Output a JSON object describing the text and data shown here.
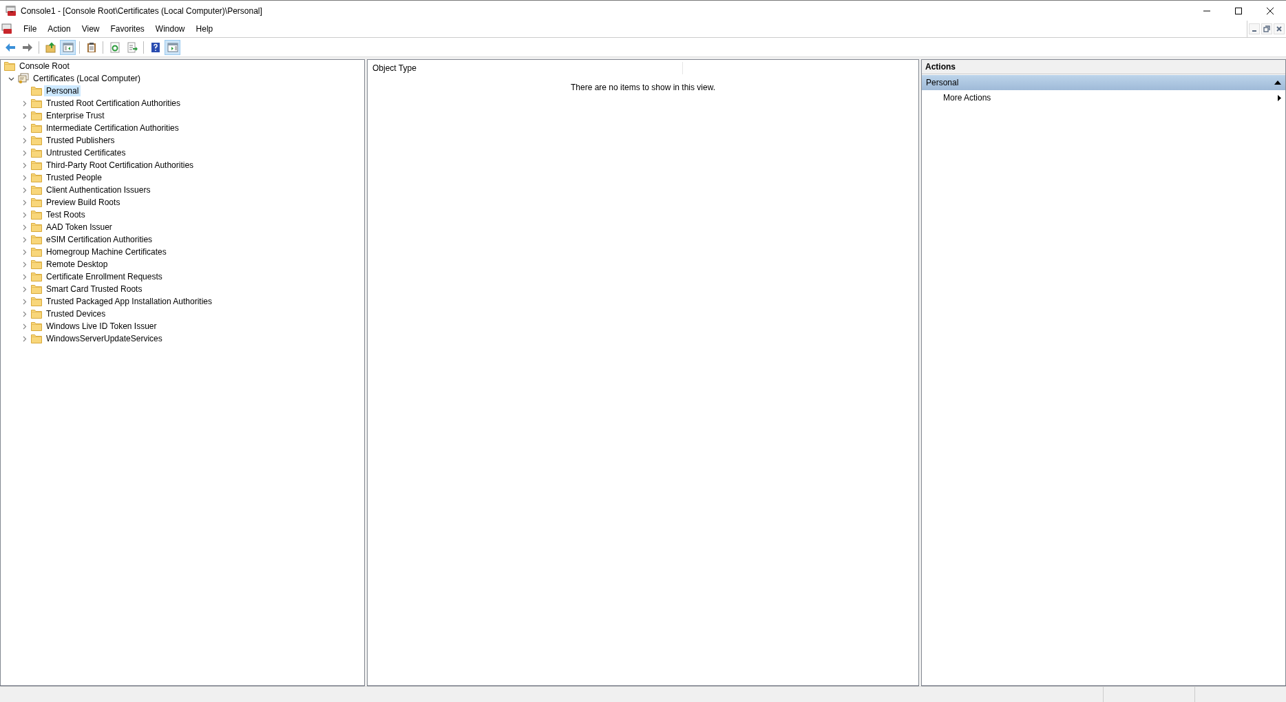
{
  "window": {
    "title": "Console1 - [Console Root\\Certificates (Local Computer)\\Personal]"
  },
  "menu": [
    "File",
    "Action",
    "View",
    "Favorites",
    "Window",
    "Help"
  ],
  "toolbar": [
    [
      {
        "kind": "back",
        "pressed": false
      },
      {
        "kind": "forward",
        "pressed": false
      }
    ],
    [
      {
        "kind": "up",
        "pressed": false
      },
      {
        "kind": "tree",
        "pressed": true
      }
    ],
    [
      {
        "kind": "clipboard",
        "pressed": false
      }
    ],
    [
      {
        "kind": "refresh",
        "pressed": false
      },
      {
        "kind": "export",
        "pressed": false
      }
    ],
    [
      {
        "kind": "help",
        "pressed": false
      },
      {
        "kind": "actions",
        "pressed": true
      }
    ]
  ],
  "tree": [
    {
      "label": "Console Root",
      "selected": false,
      "children": [
        {
          "label": "Certificates (Local Computer)",
          "kind": "store",
          "expanded": true,
          "selected": false,
          "children": [
            {
              "label": "Personal",
              "kind": "leaf",
              "selected": true
            },
            {
              "label": "Trusted Root Certification Authorities",
              "kind": "folder",
              "expanded": false,
              "selected": false
            },
            {
              "label": "Enterprise Trust",
              "kind": "folder",
              "expanded": false,
              "selected": false
            },
            {
              "label": "Intermediate Certification Authorities",
              "kind": "folder",
              "expanded": false,
              "selected": false
            },
            {
              "label": "Trusted Publishers",
              "kind": "folder",
              "expanded": false,
              "selected": false
            },
            {
              "label": "Untrusted Certificates",
              "kind": "folder",
              "expanded": false,
              "selected": false
            },
            {
              "label": "Third-Party Root Certification Authorities",
              "kind": "folder",
              "expanded": false,
              "selected": false
            },
            {
              "label": "Trusted People",
              "kind": "folder",
              "expanded": false,
              "selected": false
            },
            {
              "label": "Client Authentication Issuers",
              "kind": "folder",
              "expanded": false,
              "selected": false
            },
            {
              "label": "Preview Build Roots",
              "kind": "folder",
              "expanded": false,
              "selected": false
            },
            {
              "label": "Test Roots",
              "kind": "folder",
              "expanded": false,
              "selected": false
            },
            {
              "label": "AAD Token Issuer",
              "kind": "folder",
              "expanded": false,
              "selected": false
            },
            {
              "label": "eSIM Certification Authorities",
              "kind": "folder",
              "expanded": false,
              "selected": false
            },
            {
              "label": "Homegroup Machine Certificates",
              "kind": "folder",
              "expanded": false,
              "selected": false
            },
            {
              "label": "Remote Desktop",
              "kind": "folder",
              "expanded": false,
              "selected": false
            },
            {
              "label": "Certificate Enrollment Requests",
              "kind": "folder",
              "expanded": false,
              "selected": false
            },
            {
              "label": "Smart Card Trusted Roots",
              "kind": "folder",
              "expanded": false,
              "selected": false
            },
            {
              "label": "Trusted Packaged App Installation Authorities",
              "kind": "folder",
              "expanded": false,
              "selected": false
            },
            {
              "label": "Trusted Devices",
              "kind": "folder",
              "expanded": false,
              "selected": false
            },
            {
              "label": "Windows Live ID Token Issuer",
              "kind": "folder",
              "expanded": false,
              "selected": false
            },
            {
              "label": "WindowsServerUpdateServices",
              "kind": "folder",
              "expanded": false,
              "selected": false
            }
          ]
        }
      ]
    }
  ],
  "list": {
    "columns": [
      "Object Type"
    ],
    "empty_message": "There are no items to show in this view."
  },
  "actions": {
    "title": "Actions",
    "sections": [
      {
        "title": "Personal",
        "expanded": true,
        "items": [
          {
            "label": "More Actions",
            "submenu": true
          }
        ]
      }
    ]
  }
}
